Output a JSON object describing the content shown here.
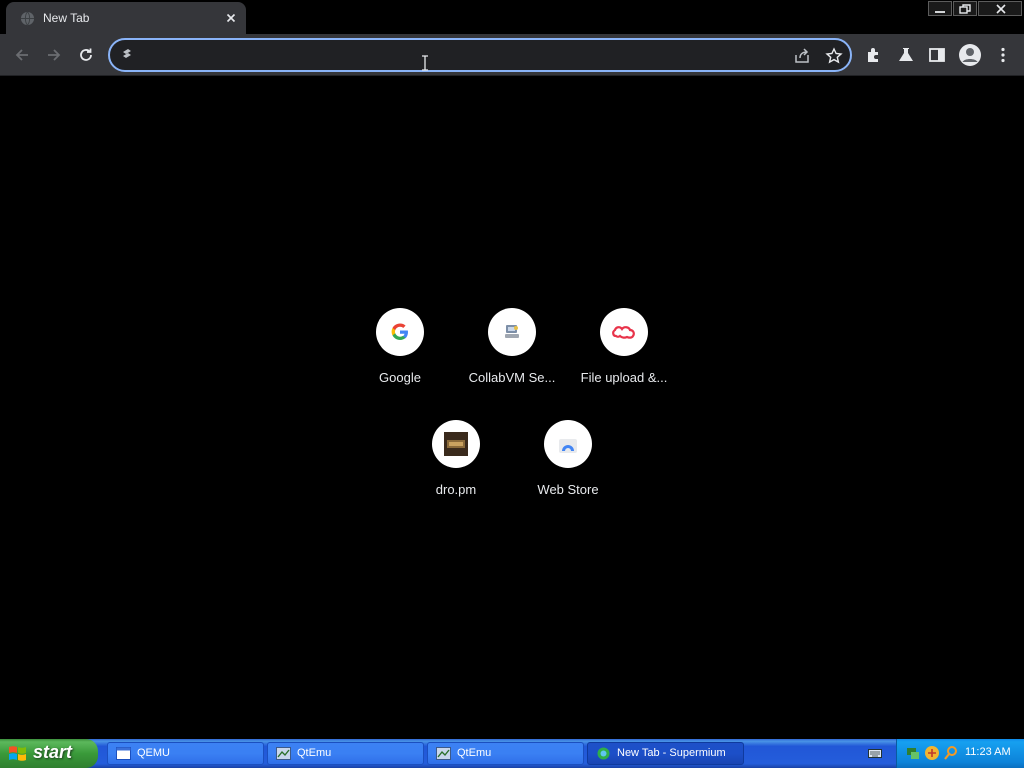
{
  "browser": {
    "tab": {
      "title": "New Tab"
    },
    "omnibox": {
      "value": "",
      "placeholder": ""
    }
  },
  "shortcuts": [
    {
      "label": "Google",
      "icon": "google-g-icon"
    },
    {
      "label": "CollabVM Se...",
      "icon": "collabvm-icon"
    },
    {
      "label": "File upload &...",
      "icon": "file-upload-site-icon"
    },
    {
      "label": "dro.pm",
      "icon": "dro-pm-icon"
    },
    {
      "label": "Web Store",
      "icon": "web-store-icon"
    }
  ],
  "taskbar": {
    "start_label": "start",
    "tasks": [
      {
        "label": "QEMU"
      },
      {
        "label": "QtEmu"
      },
      {
        "label": "QtEmu"
      },
      {
        "label": "New Tab - Supermium"
      }
    ],
    "clock": "11:23 AM"
  },
  "colors": {
    "focus_ring": "#8ab4f8",
    "toolbar": "#35363a",
    "page_bg": "#000000",
    "taskbar_blue": "#245ddb",
    "start_green": "#3a9a3a"
  }
}
